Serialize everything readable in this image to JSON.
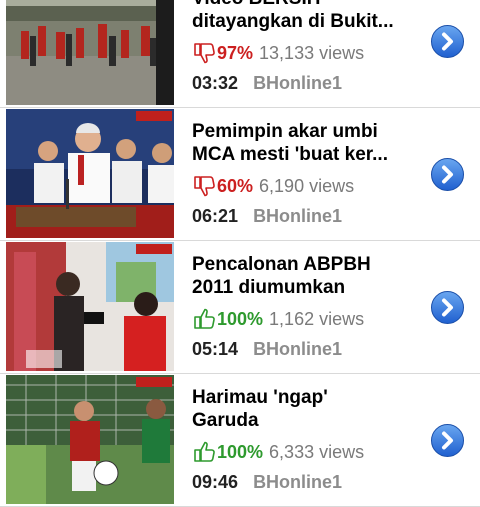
{
  "colors": {
    "rating_down": "#cc2020",
    "rating_up": "#2e9a2e",
    "views": "#7a7a7a",
    "channel": "#8c8c8c",
    "disclosure_blue": "#2f74d8"
  },
  "videos": [
    {
      "title_line1": "Video BERSIH",
      "title_line2": "ditayangkan di Bukit...",
      "rating_icon": "thumbs-down-icon",
      "rating": "97%",
      "views": "13,133 views",
      "duration": "03:32",
      "channel": "BHonline1"
    },
    {
      "title_line1": "Pemimpin akar umbi",
      "title_line2": "MCA mesti 'buat ker...",
      "rating_icon": "thumbs-down-icon",
      "rating": "60%",
      "views": "6,190 views",
      "duration": "06:21",
      "channel": "BHonline1"
    },
    {
      "title_line1": "Pencalonan ABPBH",
      "title_line2": "2011 diumumkan",
      "rating_icon": "thumbs-up-icon",
      "rating": "100%",
      "views": "1,162 views",
      "duration": "05:14",
      "channel": "BHonline1"
    },
    {
      "title_line1": "Harimau 'ngap'",
      "title_line2": "Garuda",
      "rating_icon": "thumbs-up-icon",
      "rating": "100%",
      "views": "6,333 views",
      "duration": "09:46",
      "channel": "BHonline1"
    }
  ]
}
